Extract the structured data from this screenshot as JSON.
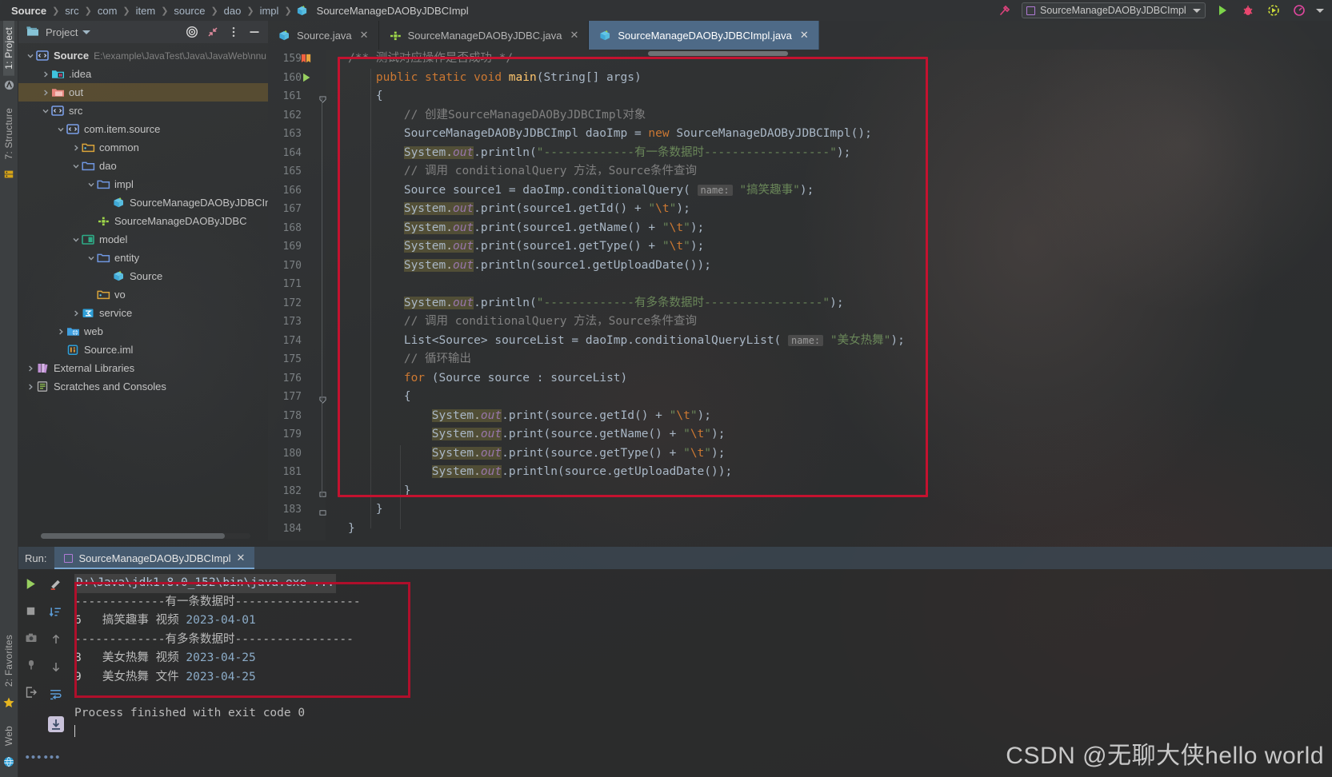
{
  "breadcrumb": {
    "items": [
      "Source",
      "src",
      "com",
      "item",
      "source",
      "dao",
      "impl",
      "SourceManageDAOByJDBCImpl"
    ]
  },
  "toolbar": {
    "run_config": "SourceManageDAOByJDBCImpl",
    "run_icon": "run-triangle-icon",
    "debug_icon": "bug-icon",
    "coverage_icon": "coverage-icon",
    "profiler_icon": "profiler-icon",
    "build_icon": "hammer-icon",
    "dropdown_caret": "chevron-down-icon"
  },
  "left_strip": {
    "tabs": [
      "1: Project",
      "7: Structure",
      "2: Favorites",
      "Web"
    ]
  },
  "project": {
    "title": "Project",
    "actions": [
      "target-icon",
      "collapse-all-icon",
      "more-options-icon",
      "hide-icon"
    ],
    "tree": [
      {
        "depth": 0,
        "arrow": "down",
        "icon": "module-icon",
        "label": "Source",
        "bold": true,
        "path": "E:\\example\\JavaTest\\Java\\JavaWeb\\nnu",
        "highlight": false
      },
      {
        "depth": 1,
        "arrow": "right",
        "icon": "idea-folder-icon",
        "label": ".idea",
        "bold": false,
        "path": "",
        "highlight": false
      },
      {
        "depth": 1,
        "arrow": "right",
        "icon": "out-folder-icon",
        "label": "out",
        "bold": false,
        "path": "",
        "highlight": true
      },
      {
        "depth": 1,
        "arrow": "down",
        "icon": "src-folder-icon",
        "label": "src",
        "bold": false,
        "path": "",
        "highlight": false
      },
      {
        "depth": 2,
        "arrow": "down",
        "icon": "package-icon",
        "label": "com.item.source",
        "bold": false,
        "path": "",
        "highlight": false
      },
      {
        "depth": 3,
        "arrow": "right",
        "icon": "yellow-folder-icon",
        "label": "common",
        "bold": false,
        "path": "",
        "highlight": false
      },
      {
        "depth": 3,
        "arrow": "down",
        "icon": "blue-folder-icon",
        "label": "dao",
        "bold": false,
        "path": "",
        "highlight": false
      },
      {
        "depth": 4,
        "arrow": "down",
        "icon": "blue-folder-icon",
        "label": "impl",
        "bold": false,
        "path": "",
        "highlight": false
      },
      {
        "depth": 5,
        "arrow": "none",
        "icon": "java-class-icon",
        "label": "SourceManageDAOByJDBCIm",
        "bold": false,
        "path": "",
        "highlight": false
      },
      {
        "depth": 4,
        "arrow": "none",
        "icon": "java-interface-icon",
        "label": "SourceManageDAOByJDBC",
        "bold": false,
        "path": "",
        "highlight": false
      },
      {
        "depth": 3,
        "arrow": "down",
        "icon": "model-folder-icon",
        "label": "model",
        "bold": false,
        "path": "",
        "highlight": false
      },
      {
        "depth": 4,
        "arrow": "down",
        "icon": "blue-folder-icon",
        "label": "entity",
        "bold": false,
        "path": "",
        "highlight": false
      },
      {
        "depth": 5,
        "arrow": "none",
        "icon": "java-class-icon",
        "label": "Source",
        "bold": false,
        "path": "",
        "highlight": false
      },
      {
        "depth": 4,
        "arrow": "none",
        "icon": "yellow-folder-icon",
        "label": "vo",
        "bold": false,
        "path": "",
        "highlight": false
      },
      {
        "depth": 3,
        "arrow": "right",
        "icon": "service-folder-icon",
        "label": "service",
        "bold": false,
        "path": "",
        "highlight": false
      },
      {
        "depth": 2,
        "arrow": "right",
        "icon": "web-folder-icon",
        "label": "web",
        "bold": false,
        "path": "",
        "highlight": false
      },
      {
        "depth": 2,
        "arrow": "none",
        "icon": "iml-file-icon",
        "label": "Source.iml",
        "bold": false,
        "path": "",
        "highlight": false
      },
      {
        "depth": 0,
        "arrow": "right",
        "icon": "libraries-icon",
        "label": "External Libraries",
        "bold": false,
        "path": "",
        "highlight": false
      },
      {
        "depth": 0,
        "arrow": "right",
        "icon": "scratches-icon",
        "label": "Scratches and Consoles",
        "bold": false,
        "path": "",
        "highlight": false
      }
    ]
  },
  "editor": {
    "tabs": [
      {
        "label": "Source.java",
        "icon": "java-class-icon",
        "active": false,
        "closable": true
      },
      {
        "label": "SourceManageDAOByJDBC.java",
        "icon": "java-interface-icon",
        "active": false,
        "closable": true
      },
      {
        "label": "SourceManageDAOByJDBCImpl.java",
        "icon": "java-class-icon",
        "active": true,
        "closable": true
      }
    ],
    "first_line": 159,
    "line_numbers": [
      159,
      160,
      161,
      162,
      163,
      164,
      165,
      166,
      167,
      168,
      169,
      170,
      171,
      172,
      173,
      174,
      175,
      176,
      177,
      178,
      179,
      180,
      181,
      182,
      183,
      184
    ],
    "gutter_marks": {
      "bookmark_line": 159,
      "run_line": 160
    },
    "code": [
      {
        "n": 159,
        "html": "<span class=\"cmt\">/** 测试对应操作是否成功 */</span>"
      },
      {
        "n": 160,
        "html": "    <span class=\"kw\">public static void</span> <span class=\"fn\">main</span><span class=\"brk\">(</span><span class=\"typ\">String</span><span class=\"brk\">[] </span><span class=\"pln\">args</span><span class=\"brk\">)</span>"
      },
      {
        "n": 161,
        "html": "    <span class=\"brk\">{</span>"
      },
      {
        "n": 162,
        "html": "        <span class=\"cmt\">// 创建SourceManageDAOByJDBCImpl对象</span>"
      },
      {
        "n": 163,
        "html": "        <span class=\"typ\">SourceManageDAOByJDBCImpl</span> <span class=\"pln\">daoImp</span> <span class=\"brk\">=</span> <span class=\"kw\">new</span> <span class=\"typ\">SourceManageDAOByJDBCImpl</span><span class=\"brk\">();</span>"
      },
      {
        "n": 164,
        "html": "        <span class=\"hlsys\"><span class=\"typ\">System</span>.<span class=\"fld\">out</span></span><span class=\"pln\">.println(</span><span class=\"str\">\"-------------有一条数据时------------------\"</span><span class=\"brk\">);</span>"
      },
      {
        "n": 165,
        "html": "        <span class=\"cmt\">// 调用 conditionalQuery 方法，Source条件查询</span>"
      },
      {
        "n": 166,
        "html": "        <span class=\"typ\">Source</span> <span class=\"pln\">source1</span> <span class=\"brk\">=</span> <span class=\"pln\">daoImp.conditionalQuery(</span> <span class=\"hint\">name:</span> <span class=\"str\">\"搞笑趣事\"</span><span class=\"brk\">);</span>"
      },
      {
        "n": 167,
        "html": "        <span class=\"hlsys\"><span class=\"typ\">System</span>.<span class=\"fld\">out</span></span><span class=\"pln\">.print(source1.getId() + </span><span class=\"str\">\"</span><span class=\"kw\">\\t</span><span class=\"str\">\"</span><span class=\"brk\">);</span>"
      },
      {
        "n": 168,
        "html": "        <span class=\"hlsys\"><span class=\"typ\">System</span>.<span class=\"fld\">out</span></span><span class=\"pln\">.print(source1.getName() + </span><span class=\"str\">\"</span><span class=\"kw\">\\t</span><span class=\"str\">\"</span><span class=\"brk\">);</span>"
      },
      {
        "n": 169,
        "html": "        <span class=\"hlsys\"><span class=\"typ\">System</span>.<span class=\"fld\">out</span></span><span class=\"pln\">.print(source1.getType() + </span><span class=\"str\">\"</span><span class=\"kw\">\\t</span><span class=\"str\">\"</span><span class=\"brk\">);</span>"
      },
      {
        "n": 170,
        "html": "        <span class=\"hlsys\"><span class=\"typ\">System</span>.<span class=\"fld\">out</span></span><span class=\"pln\">.println(source1.getUploadDate());</span>"
      },
      {
        "n": 171,
        "html": ""
      },
      {
        "n": 172,
        "html": "        <span class=\"hlsys\"><span class=\"typ\">System</span>.<span class=\"fld\">out</span></span><span class=\"pln\">.println(</span><span class=\"str\">\"-------------有多条数据时-----------------\"</span><span class=\"brk\">);</span>"
      },
      {
        "n": 173,
        "html": "        <span class=\"cmt\">// 调用 conditionalQuery 方法，Source条件查询</span>"
      },
      {
        "n": 174,
        "html": "        <span class=\"typ\">List&lt;Source&gt;</span> <span class=\"pln\">sourceList</span> <span class=\"brk\">=</span> <span class=\"pln\">daoImp.conditionalQueryList(</span> <span class=\"hint\">name:</span> <span class=\"str\">\"美女热舞\"</span><span class=\"brk\">);</span>"
      },
      {
        "n": 175,
        "html": "        <span class=\"cmt\">// 循环输出</span>"
      },
      {
        "n": 176,
        "html": "        <span class=\"kw\">for</span> <span class=\"brk\">(</span><span class=\"typ\">Source</span> <span class=\"pln\">source</span> <span class=\"brk\">:</span> <span class=\"pln\">sourceList</span><span class=\"brk\">)</span>"
      },
      {
        "n": 177,
        "html": "        <span class=\"brk\">{</span>"
      },
      {
        "n": 178,
        "html": "            <span class=\"hlsys\"><span class=\"typ\">System</span>.<span class=\"fld\">out</span></span><span class=\"pln\">.print(source.getId() + </span><span class=\"str\">\"</span><span class=\"kw\">\\t</span><span class=\"str\">\"</span><span class=\"brk\">);</span>"
      },
      {
        "n": 179,
        "html": "            <span class=\"hlsys\"><span class=\"typ\">System</span>.<span class=\"fld\">out</span></span><span class=\"pln\">.print(source.getName() + </span><span class=\"str\">\"</span><span class=\"kw\">\\t</span><span class=\"str\">\"</span><span class=\"brk\">);</span>"
      },
      {
        "n": 180,
        "html": "            <span class=\"hlsys\"><span class=\"typ\">System</span>.<span class=\"fld\">out</span></span><span class=\"pln\">.print(source.getType() + </span><span class=\"str\">\"</span><span class=\"kw\">\\t</span><span class=\"str\">\"</span><span class=\"brk\">);</span>"
      },
      {
        "n": 181,
        "html": "            <span class=\"hlsys\"><span class=\"typ\">System</span>.<span class=\"fld\">out</span></span><span class=\"pln\">.println(source.getUploadDate());</span>"
      },
      {
        "n": 182,
        "html": "        <span class=\"brk\">}</span>"
      },
      {
        "n": 183,
        "html": "    <span class=\"brk\">}</span>"
      },
      {
        "n": 184,
        "html": "<span class=\"brk\">}</span>"
      }
    ]
  },
  "run_window": {
    "label": "Run:",
    "tab_label": "SourceManageDAOByJDBCImpl",
    "left_tools": [
      "rerun-icon",
      "stop-icon",
      "camera-icon",
      "plug-icon",
      "export-icon"
    ],
    "right_tools": [
      "edit-icon",
      "sort-icon",
      "up-arrow-icon",
      "down-arrow-icon",
      "wrap-icon",
      "scroll-to-end-icon",
      "more-icon"
    ],
    "console": [
      {
        "type": "cmd",
        "text": "D:\\Java\\jdk1.8.0_152\\bin\\java.exe ..."
      },
      {
        "type": "text",
        "text": "-------------有一条数据时------------------"
      },
      {
        "type": "row",
        "id": "6",
        "name": "搞笑趣事",
        "kind": "视频",
        "date": "2023-04-01"
      },
      {
        "type": "text",
        "text": "-------------有多条数据时-----------------"
      },
      {
        "type": "row",
        "id": "8",
        "name": "美女热舞",
        "kind": "视频",
        "date": "2023-04-25"
      },
      {
        "type": "row",
        "id": "9",
        "name": "美女热舞",
        "kind": "文件",
        "date": "2023-04-25"
      },
      {
        "type": "text",
        "text": "Process finished with exit code 0"
      }
    ]
  },
  "watermark": "CSDN @无聊大侠hello world",
  "colors": {
    "accent_tab": "#4e6a87",
    "redbox": "#c4122f",
    "keyword": "#cc7832",
    "string": "#6a8759",
    "comment": "#808080",
    "field": "#9876aa",
    "method": "#ffc66d",
    "number": "#6897bb"
  }
}
